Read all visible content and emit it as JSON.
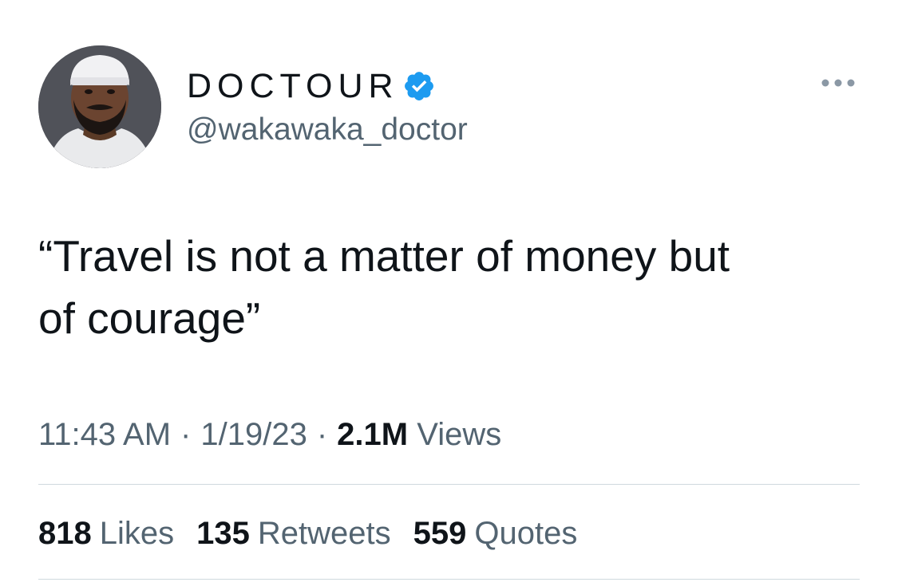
{
  "author": {
    "display_name": "DOCTOUR",
    "handle": "@wakawaka_doctor",
    "verified": true,
    "verified_color": "#1d9bf0"
  },
  "tweet": {
    "text": "“Travel is not a matter of money but\nof courage”",
    "time": "11:43 AM",
    "date": "1/19/23",
    "views_count": "2.1M",
    "views_label": "Views",
    "separator": "·"
  },
  "stats": {
    "likes_count": "818",
    "likes_label": "Likes",
    "retweets_count": "135",
    "retweets_label": "Retweets",
    "quotes_count": "559",
    "quotes_label": "Quotes"
  },
  "icons": {
    "more": "more-horizontal-icon",
    "verified": "verified-badge-icon"
  },
  "colors": {
    "text_primary": "#0f1419",
    "text_secondary": "#536471",
    "divider": "#cfd9de"
  }
}
